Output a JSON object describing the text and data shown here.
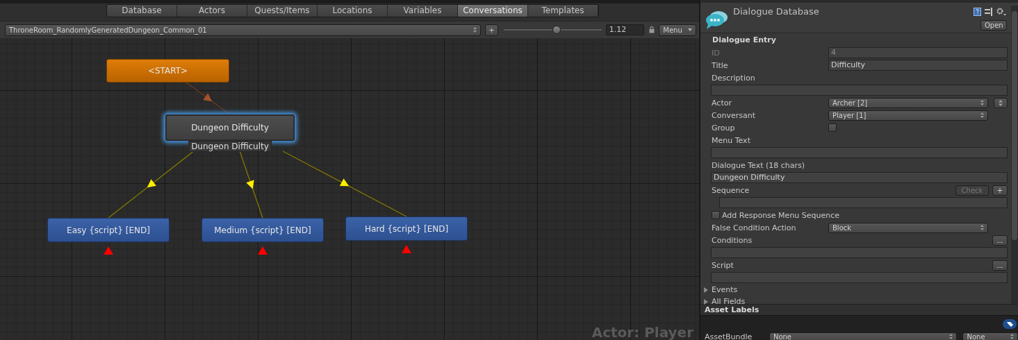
{
  "tabs": [
    {
      "label": "Database",
      "selected": false
    },
    {
      "label": "Actors",
      "selected": false
    },
    {
      "label": "Quests/Items",
      "selected": false
    },
    {
      "label": "Locations",
      "selected": false
    },
    {
      "label": "Variables",
      "selected": false
    },
    {
      "label": "Conversations",
      "selected": true
    },
    {
      "label": "Templates",
      "selected": false
    }
  ],
  "toolbar": {
    "conversation": "ThroneRoom_RandomlyGeneratedDungeon_Common_01",
    "add_button": "+",
    "zoom": {
      "level": 0.53,
      "reading": "1.12"
    },
    "menu": "Menu"
  },
  "graph": {
    "nodes": [
      {
        "kind": "start",
        "label": "<START>",
        "selected": false,
        "children": [
          {
            "kind": "dialogue",
            "label": "Dungeon Difficulty",
            "caption": "Dungeon Difficulty",
            "selected": true,
            "children": [
              {
                "kind": "end",
                "label": "Easy {script} [END]",
                "selected": false
              },
              {
                "kind": "end",
                "label": "Medium {script} [END]",
                "selected": false
              },
              {
                "kind": "end",
                "label": "Hard {script} [END]",
                "selected": false
              }
            ]
          }
        ]
      }
    ],
    "actor_label": "Actor: Player"
  },
  "inspector": {
    "title": "Dialogue Database",
    "open_button": "Open",
    "section": "Dialogue Entry",
    "fields": [
      {
        "kind": "field",
        "label": "ID",
        "value": "4",
        "disabled": true
      },
      {
        "kind": "field",
        "label": "Title",
        "value": "Difficulty",
        "disabled": false
      },
      {
        "kind": "block",
        "label": "Description"
      },
      {
        "kind": "dropdown",
        "label": "Actor",
        "value": "Archer [2]",
        "swap_button": true
      },
      {
        "kind": "dropdown",
        "label": "Conversant",
        "value": "Player [1]",
        "swap_button": false
      },
      {
        "kind": "checkbox",
        "label": "Group",
        "checked": false
      },
      {
        "kind": "block",
        "label": "Menu Text"
      },
      {
        "kind": "block",
        "label": "Dialogue Text (18 chars)",
        "value": "Dungeon Difficulty"
      },
      {
        "kind": "block",
        "label": "Sequence",
        "indented": true,
        "buttons": [
          {
            "label": "Check",
            "disabled": true
          },
          {
            "label": "+",
            "disabled": false
          }
        ]
      },
      {
        "kind": "toggle",
        "label": "Add Response Menu Sequence",
        "checked": false
      },
      {
        "kind": "dropdown",
        "label": "False Condition Action",
        "value": "Block",
        "swap_button": false
      },
      {
        "kind": "block",
        "label": "Conditions",
        "buttons": [
          {
            "label": "...",
            "disabled": false
          }
        ]
      },
      {
        "kind": "block",
        "label": "Script",
        "buttons": [
          {
            "label": "...",
            "disabled": false
          }
        ]
      },
      {
        "kind": "foldout",
        "label": "Events",
        "expanded": false
      },
      {
        "kind": "foldout",
        "label": "All Fields",
        "expanded": false
      }
    ]
  },
  "asset_labels": {
    "title": "Asset Labels",
    "asset_bundle": {
      "label": "AssetBundle",
      "values": [
        "None",
        "None"
      ]
    }
  }
}
